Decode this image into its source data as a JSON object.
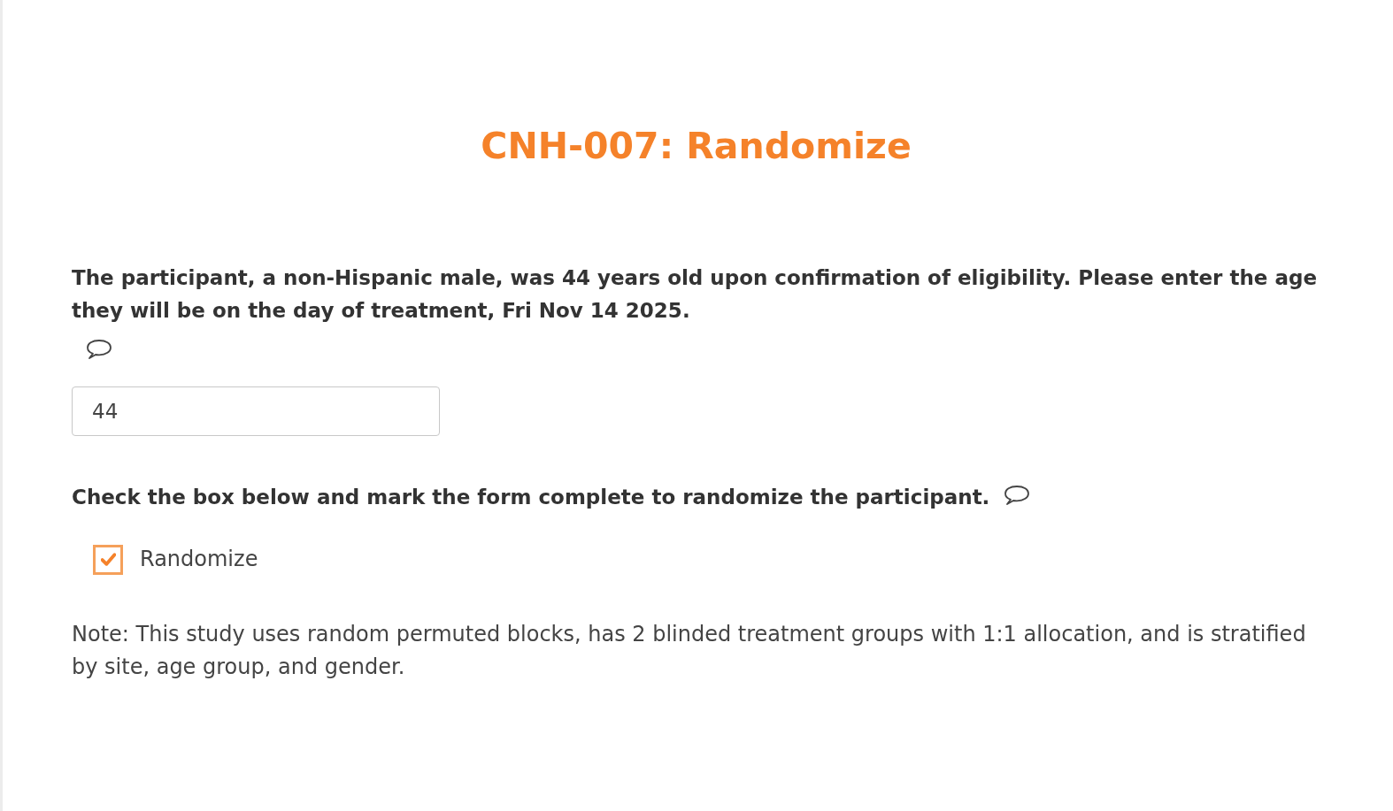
{
  "title": "CNH-007: Randomize",
  "age_question": {
    "prompt": "The participant, a non-Hispanic male, was 44 years old upon confirmation of eligibility. Please enter the age they will be on the day of treatment, Fri Nov 14 2025.",
    "value": "44"
  },
  "randomize_question": {
    "prompt": "Check the box below and mark the form complete to randomize the participant.",
    "options": [
      {
        "label": "Randomize",
        "checked": true
      }
    ]
  },
  "note": "Note: This study uses random permuted blocks, has 2 blinded treatment groups with 1:1 allocation, and is stratified by site, age group, and gender."
}
